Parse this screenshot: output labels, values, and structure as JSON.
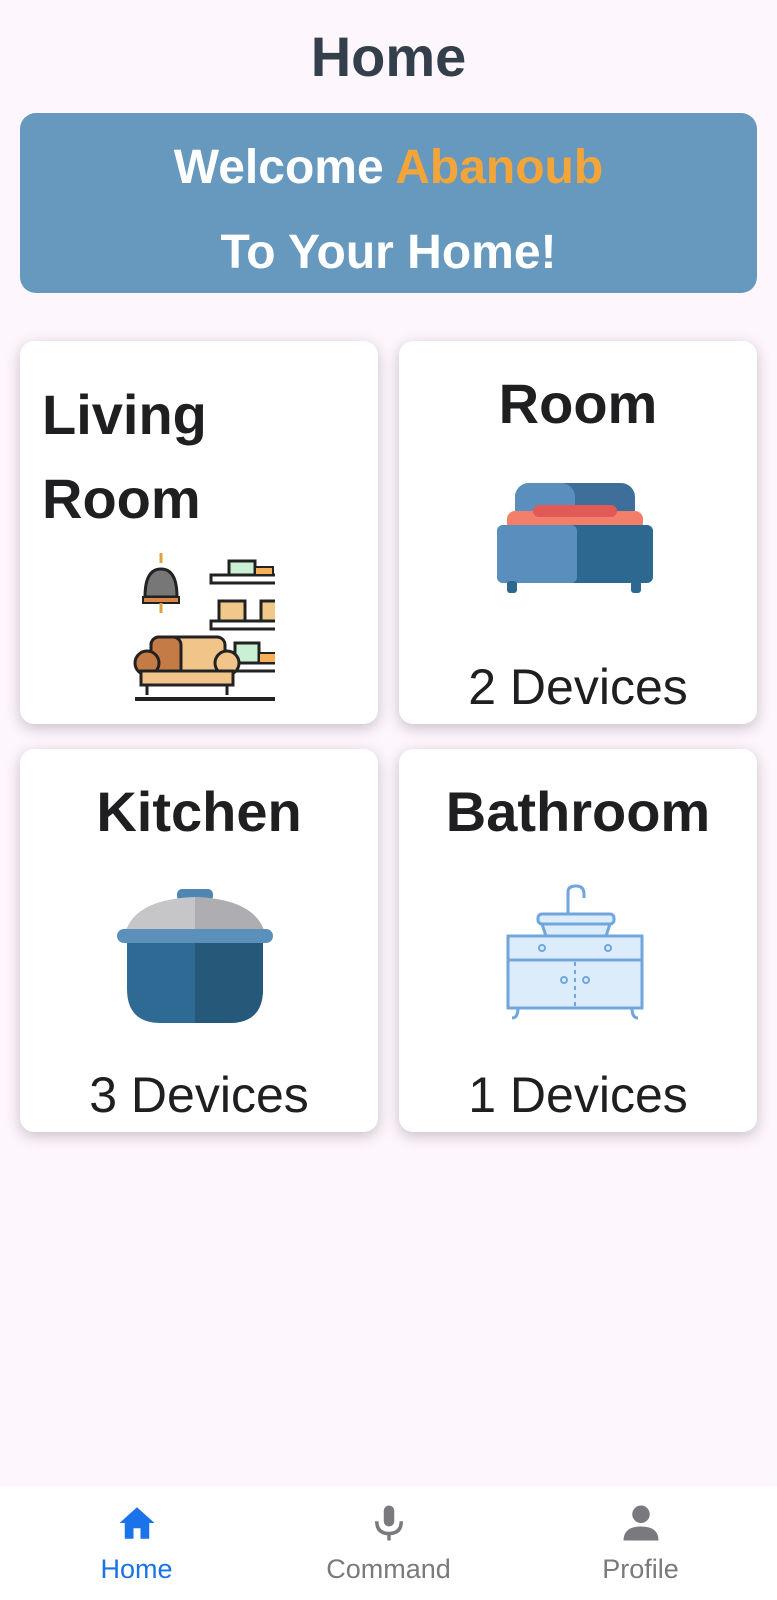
{
  "header": {
    "title": "Home"
  },
  "banner": {
    "welcome": "Welcome",
    "user_name": "Abanoub",
    "subtitle": "To Your Home!"
  },
  "rooms": [
    {
      "name": "Living Room",
      "devices": "",
      "icon": "living-room-illustration"
    },
    {
      "name": "Room",
      "devices": "2 Devices",
      "icon": "bed-icon"
    },
    {
      "name": "Kitchen",
      "devices": "3 Devices",
      "icon": "pot-icon"
    },
    {
      "name": "Bathroom",
      "devices": "1 Devices",
      "icon": "bathroom-sink-icon"
    }
  ],
  "nav": {
    "items": [
      {
        "label": "Home",
        "icon": "home-icon",
        "active": true
      },
      {
        "label": "Command",
        "icon": "microphone-icon",
        "active": false
      },
      {
        "label": "Profile",
        "icon": "person-icon",
        "active": false
      }
    ]
  },
  "colors": {
    "background": "#fdf6fc",
    "banner": "#6699bd",
    "accent_name": "#f4a53a",
    "active_nav": "#1a73e8"
  }
}
